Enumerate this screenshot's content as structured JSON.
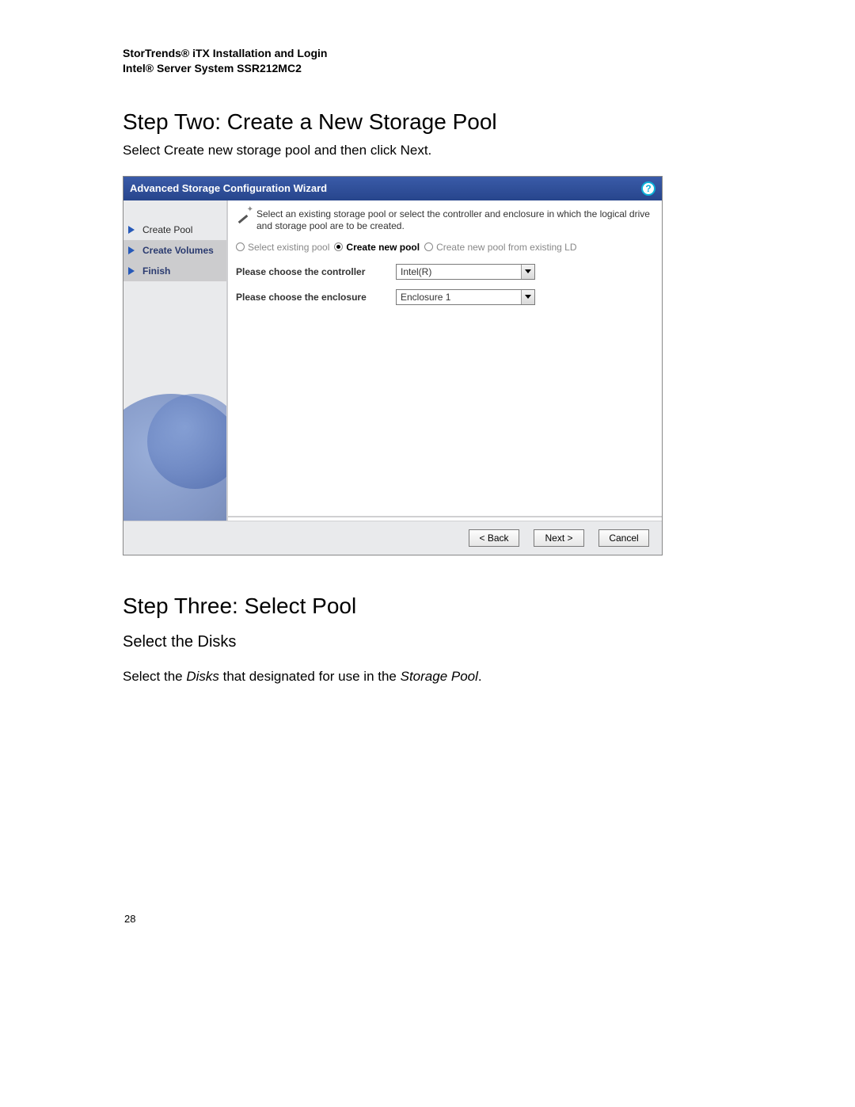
{
  "header": {
    "line1": "StorTrends® iTX Installation and Login",
    "line2": "Intel® Server System SSR212MC2"
  },
  "step_two": {
    "title": "Step Two: Create a New Storage Pool",
    "description": "Select Create new storage pool and then click Next."
  },
  "wizard": {
    "title": "Advanced Storage Configuration Wizard",
    "sidebar": {
      "items": [
        {
          "label": "Create Pool"
        },
        {
          "label": "Create Volumes"
        },
        {
          "label": "Finish"
        }
      ]
    },
    "hint": "Select an existing storage pool or select the controller and enclosure in which the logical drive and storage pool are to be created.",
    "radios": {
      "opt1": "Select existing pool",
      "opt2": "Create new pool",
      "opt3": "Create new pool from existing LD"
    },
    "fields": {
      "controller_label": "Please choose the controller",
      "controller_value": "Intel(R)",
      "enclosure_label": "Please choose the enclosure",
      "enclosure_value": "Enclosure 1"
    },
    "buttons": {
      "back": "< Back",
      "next": "Next >",
      "cancel": "Cancel"
    }
  },
  "step_three": {
    "title": "Step Three: Select Pool",
    "subhead": "Select the Disks",
    "body_prefix": "Select the ",
    "body_em1": "Disks",
    "body_mid": " that designated for use in the ",
    "body_em2": "Storage Pool",
    "body_suffix": "."
  },
  "page_number": "28"
}
